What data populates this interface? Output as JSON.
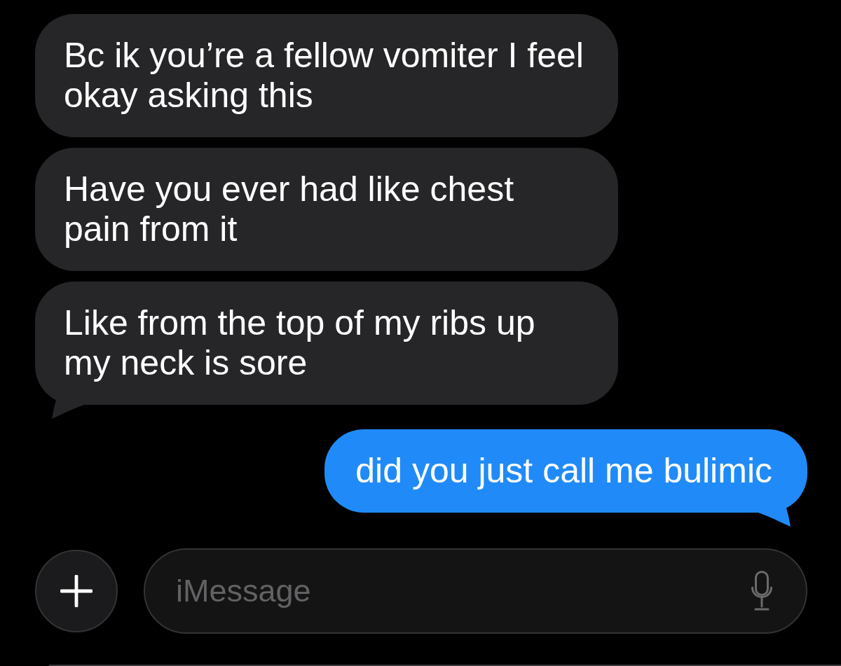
{
  "messages": [
    {
      "kind": "received",
      "text": "Bc ik you’re a fellow vomiter I feel okay asking this",
      "tail": false
    },
    {
      "kind": "received",
      "text": "Have you ever had like chest pain from it",
      "tail": false
    },
    {
      "kind": "received",
      "text": "Like from the top of my ribs up my neck is sore",
      "tail": true
    },
    {
      "kind": "sent",
      "text": "did you just call me bulimic",
      "tail": true
    }
  ],
  "composer": {
    "placeholder": "iMessage"
  }
}
